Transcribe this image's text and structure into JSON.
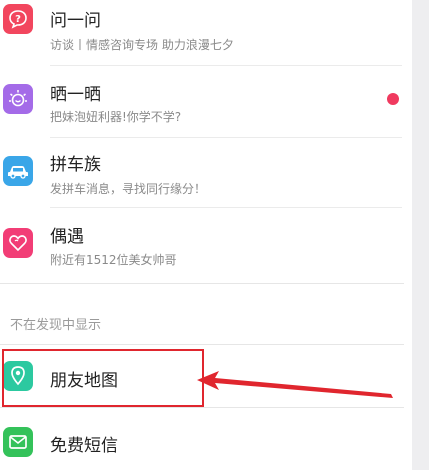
{
  "menu": {
    "items": [
      {
        "title": "问一问",
        "subtitle": "访谈丨情感咨询专场 助力浪漫七夕",
        "icon": "question-bubble-icon",
        "color": "#f2465e"
      },
      {
        "title": "晒一晒",
        "subtitle": "把妹泡妞利器!你学不学?",
        "icon": "sun-face-icon",
        "color": "#a46be8",
        "badge": true,
        "badge_color": "#f03a5f"
      },
      {
        "title": "拼车族",
        "subtitle": "发拼车消息，寻找同行缘分！",
        "icon": "car-icon",
        "color": "#3aa6e8"
      },
      {
        "title": "偶遇",
        "subtitle": "附近有1512位美女帅哥",
        "icon": "heart-icon",
        "color": "#f23d76"
      }
    ]
  },
  "hidden_section": {
    "label": "不在发现中显示",
    "items": [
      {
        "title": "朋友地图",
        "icon": "map-pin-icon",
        "color": "#2cc9a0"
      },
      {
        "title": "免费短信",
        "icon": "envelope-icon",
        "color": "#34c25a"
      }
    ]
  },
  "annotation": {
    "color": "#e0262e"
  }
}
